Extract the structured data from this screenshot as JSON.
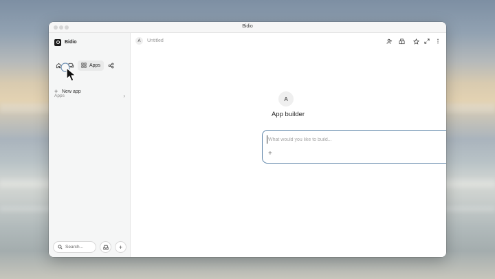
{
  "window": {
    "title": "Bidio"
  },
  "sidebar": {
    "brand": "Bidio",
    "nav": [
      {
        "icon": "home-icon"
      },
      {
        "icon": "chat-icon"
      },
      {
        "icon": "apps-grid-icon",
        "label": "Apps"
      },
      {
        "icon": "share-icon"
      }
    ],
    "new_app": {
      "icon": "plus-icon",
      "label": "New app"
    },
    "section_label": "Apps",
    "search": {
      "label": "Search..."
    },
    "inbox": {
      "icon": "inbox-icon"
    },
    "add": {
      "icon": "plus-icon",
      "glyph": "+"
    }
  },
  "main": {
    "topbar": {
      "avatar_initial": "A",
      "doc_title": "Untitled",
      "actions": [
        "share-person-icon",
        "extensions-icon",
        "star-icon",
        "expand-icon",
        "more-icon"
      ]
    },
    "hero": {
      "avatar_initial": "A",
      "title": "App builder"
    },
    "prompt": {
      "placeholder": "What would you like to build...",
      "value": "",
      "add_glyph": "+"
    }
  },
  "colors": {
    "accent": "#2f5f93",
    "prompt_border": "#5d84a8"
  }
}
